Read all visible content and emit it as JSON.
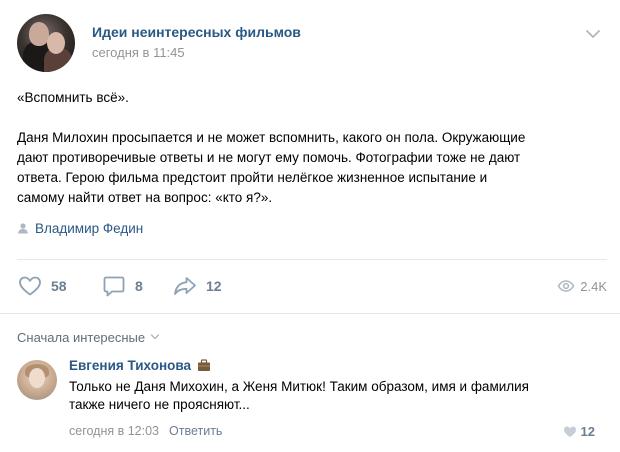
{
  "post": {
    "group_name": "Идеи неинтересных фильмов",
    "time": "сегодня в 11:45",
    "title_line": "«Вспомнить всё».",
    "body_lines": [
      "Даня Милохин просыпается и не может вспомнить, какого он пола. Окружающие",
      "дают противоречивые ответы и не могут ему помочь. Фотографии тоже не дают",
      "ответа. Герою фильма предстоит пройти нелёгкое жизненное испытание и",
      "самому найти ответ на вопрос: «кто я?»."
    ],
    "author": "Владимир Федин",
    "likes": "58",
    "comments": "8",
    "shares": "12",
    "views": "2.4K"
  },
  "sort": {
    "label": "Сначала интересные"
  },
  "comment": {
    "name": "Евгения Тихонова",
    "text_lines": [
      "Только не Даня Михохин, а Женя Митюк! Таким образом, имя и фамилия",
      "также ничего не проясняют..."
    ],
    "time": "сегодня в 12:03",
    "reply_label": "Ответить",
    "likes": "12"
  },
  "colors": {
    "link": "#2a5885",
    "secondary": "#939393",
    "action": "#6b7e94",
    "separator": "#e7e8ec"
  },
  "icons": {
    "menu": "chevron-down-icon",
    "author": "person-icon",
    "like": "heart-icon",
    "comment": "comment-icon",
    "share": "share-arrow-icon",
    "views": "eye-icon",
    "badge": "briefcase-icon"
  }
}
